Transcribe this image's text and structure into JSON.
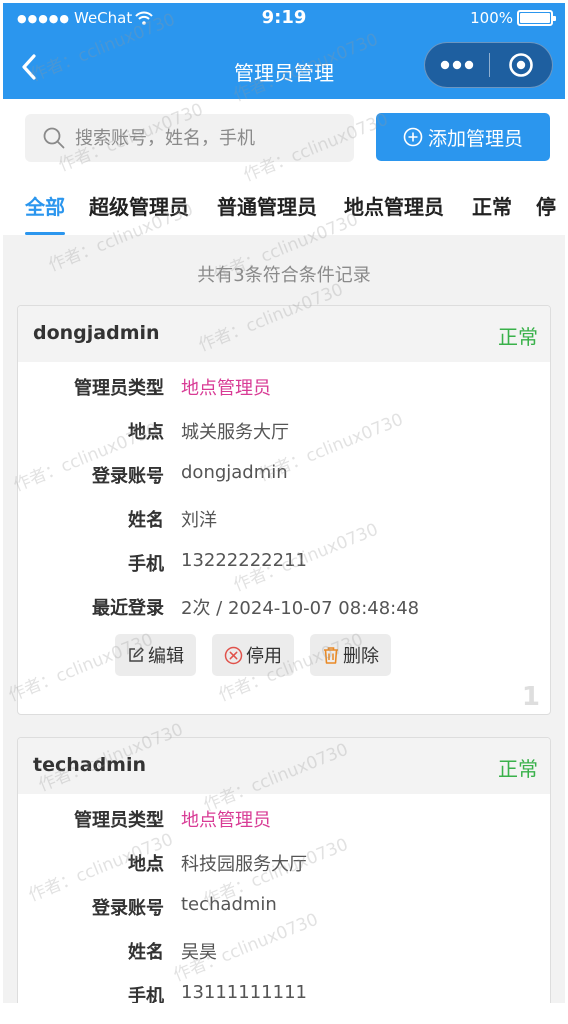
{
  "status_bar": {
    "signal": "●●●●●",
    "carrier": "WeChat",
    "time": "9:19",
    "battery": "100%"
  },
  "nav": {
    "title": "管理员管理"
  },
  "search": {
    "placeholder": "搜索账号，姓名，手机"
  },
  "add_button": {
    "label": "添加管理员"
  },
  "tabs": [
    "全部",
    "超级管理员",
    "普通管理员",
    "地点管理员",
    "正常",
    "停"
  ],
  "active_tab": "全部",
  "count_text": "共有3条符合条件记录",
  "labels": {
    "type": "管理员类型",
    "location": "地点",
    "account": "登录账号",
    "name": "姓名",
    "phone": "手机",
    "last_login": "最近登录",
    "colon": "："
  },
  "actions": {
    "edit": "编辑",
    "disable": "停用",
    "delete": "删除"
  },
  "records": [
    {
      "username": "dongjadmin",
      "status": "正常",
      "type": "地点管理员",
      "location": "城关服务大厅",
      "account": "dongjadmin",
      "name": "刘洋",
      "phone": "13222222211",
      "last_login": "2次 / 2024-10-07 08:48:48",
      "index": "1"
    },
    {
      "username": "techadmin",
      "status": "正常",
      "type": "地点管理员",
      "location": "科技园服务大厅",
      "account": "techadmin",
      "name": "吴昊",
      "phone": "13111111111"
    }
  ],
  "watermark": "作者：cclinux0730",
  "colors": {
    "primary": "#2b96ee",
    "status_green": "#39b14a",
    "type_pink": "#d83b95"
  }
}
